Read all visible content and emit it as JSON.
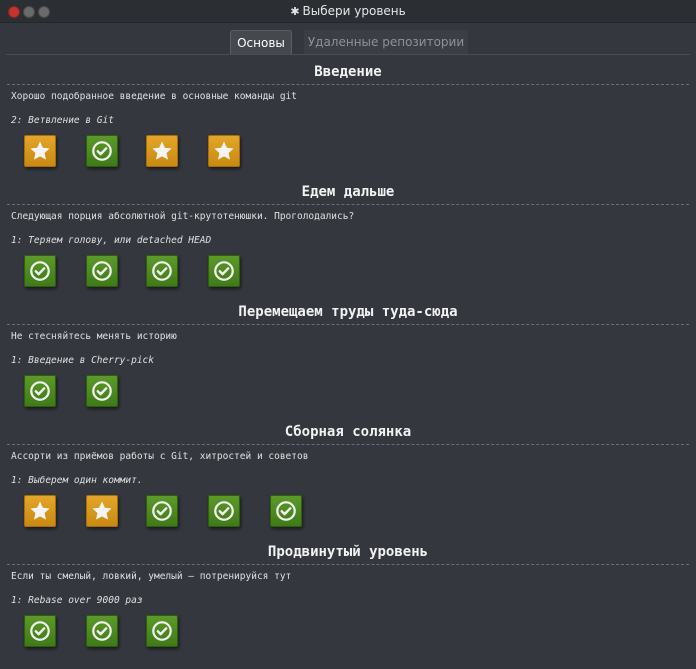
{
  "window": {
    "title": "Выбери уровень",
    "title_icon": "gear-icon"
  },
  "tabs": [
    {
      "label": "Основы",
      "active": true
    },
    {
      "label": "Удаленные репозитории",
      "active": false
    }
  ],
  "colors": {
    "background": "#34383e",
    "star_badge": "#d89a1d",
    "check_badge": "#4c8a20",
    "close_button": "#c2352f"
  },
  "sequences": [
    {
      "title": "Введение",
      "description": "Хорошо подобранное введение в основные команды git",
      "level_name": "2: Ветвление в Git",
      "levels": [
        {
          "icon": "star-icon",
          "state": "solved-optimal"
        },
        {
          "icon": "check-icon",
          "state": "solved"
        },
        {
          "icon": "star-icon",
          "state": "solved-optimal"
        },
        {
          "icon": "star-icon",
          "state": "solved-optimal"
        }
      ]
    },
    {
      "title": "Едем дальше",
      "description": "Следующая порция абсолютной git-крутотенюшки. Проголодались?",
      "level_name": "1: Теряем голову, или detached HEAD",
      "levels": [
        {
          "icon": "check-icon",
          "state": "solved"
        },
        {
          "icon": "check-icon",
          "state": "solved"
        },
        {
          "icon": "check-icon",
          "state": "solved"
        },
        {
          "icon": "check-icon",
          "state": "solved"
        }
      ]
    },
    {
      "title": "Перемещаем труды туда-сюда",
      "description": "Не стесняйтесь менять историю",
      "level_name": "1: Введение в Cherry-pick",
      "levels": [
        {
          "icon": "check-icon",
          "state": "solved"
        },
        {
          "icon": "check-icon",
          "state": "solved"
        }
      ]
    },
    {
      "title": "Сборная солянка",
      "description": "Ассорти из приёмов работы с Git, хитростей и советов",
      "level_name": "1: Выберем один коммит.",
      "levels": [
        {
          "icon": "star-icon",
          "state": "solved-optimal"
        },
        {
          "icon": "star-icon",
          "state": "solved-optimal"
        },
        {
          "icon": "check-icon",
          "state": "solved"
        },
        {
          "icon": "check-icon",
          "state": "solved"
        },
        {
          "icon": "check-icon",
          "state": "solved"
        }
      ]
    },
    {
      "title": "Продвинутый уровень",
      "description": "Если ты смелый, ловкий, умелый – потренируйся тут",
      "level_name": "1: Rebase over 9000 раз",
      "levels": [
        {
          "icon": "check-icon",
          "state": "solved"
        },
        {
          "icon": "check-icon",
          "state": "solved"
        },
        {
          "icon": "check-icon",
          "state": "solved"
        }
      ]
    }
  ]
}
